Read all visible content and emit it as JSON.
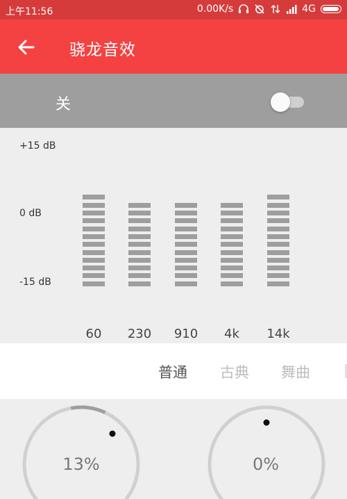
{
  "status_bar": {
    "time": "上午11:56",
    "net_speed": "0.00K/s",
    "network": "4G",
    "icons": [
      "headphones-icon",
      "alarm-off-icon",
      "data-arrows-icon",
      "signal-icon",
      "battery-icon"
    ]
  },
  "app_bar": {
    "title": "骁龙音效",
    "back_icon": "arrow-left-icon"
  },
  "toggle": {
    "label": "关",
    "on": false
  },
  "equalizer": {
    "db_labels": [
      "+15 dB",
      "0 dB",
      "-15 dB"
    ],
    "bands": [
      {
        "freq": "60",
        "segments": 12
      },
      {
        "freq": "230",
        "segments": 11
      },
      {
        "freq": "910",
        "segments": 11
      },
      {
        "freq": "4k",
        "segments": 11
      },
      {
        "freq": "14k",
        "segments": 12
      }
    ]
  },
  "presets": [
    {
      "label": "普通",
      "active": true
    },
    {
      "label": "古典",
      "active": false
    },
    {
      "label": "舞曲",
      "active": false
    }
  ],
  "knobs": [
    {
      "value_label": "13%",
      "value": 13
    },
    {
      "value_label": "0%",
      "value": 0
    }
  ],
  "colors": {
    "status_bar": "#d63b3b",
    "app_bar": "#f44242",
    "toggle_row": "#9e9e9e",
    "eq_segment": "#9e9e9e"
  }
}
